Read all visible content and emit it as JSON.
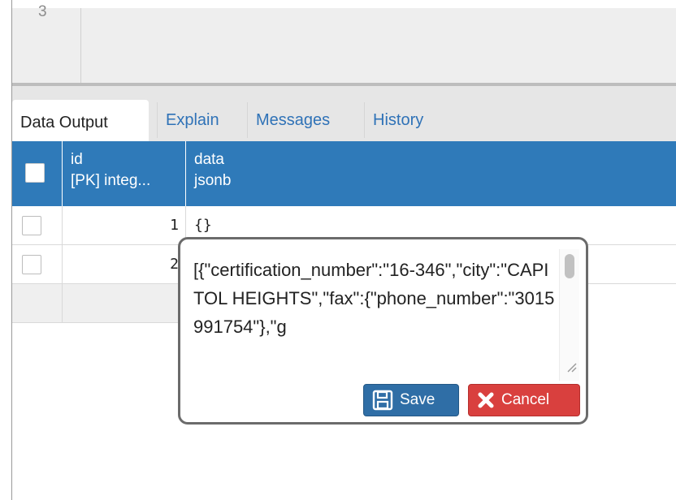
{
  "editor": {
    "line_number": "3"
  },
  "tabs": [
    {
      "label": "Data Output",
      "active": true
    },
    {
      "label": "Explain",
      "active": false
    },
    {
      "label": "Messages",
      "active": false
    },
    {
      "label": "History",
      "active": false
    }
  ],
  "grid": {
    "columns": [
      {
        "name": "id",
        "type": "[PK] integ..."
      },
      {
        "name": "data",
        "type": "jsonb"
      }
    ],
    "rows": [
      {
        "id": "1",
        "data": "{}"
      },
      {
        "id": "2",
        "data": ""
      }
    ]
  },
  "popup": {
    "text": "[{\"certification_number\":\"16-346\",\"city\":\"CAPITOL HEIGHTS\",\"fax\":{\"phone_number\":\"3015991754\"},\"g",
    "save_label": "Save",
    "cancel_label": "Cancel"
  },
  "colors": {
    "header_blue": "#2f7ab9",
    "save_blue": "#2f6ea6",
    "cancel_red": "#d9403e",
    "tab_link": "#2f72b7"
  },
  "icons": {
    "save": "floppy-disk-icon",
    "cancel": "x-icon",
    "resize": "resize-handle-icon"
  }
}
